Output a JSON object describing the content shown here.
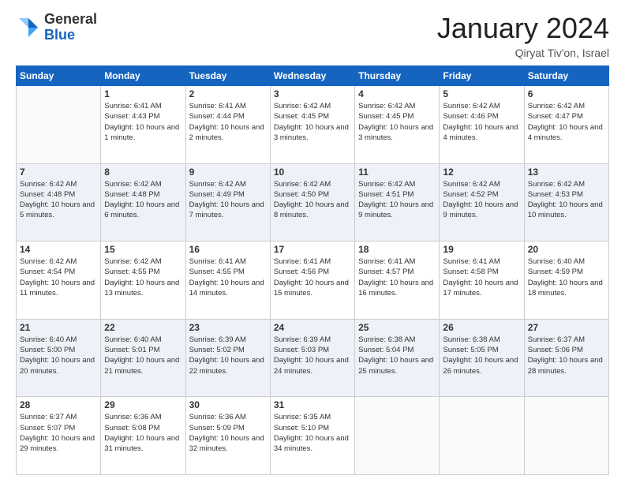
{
  "header": {
    "logo": {
      "line1": "General",
      "line2": "Blue"
    },
    "title": "January 2024",
    "location": "Qiryat Tiv'on, Israel"
  },
  "columns": [
    "Sunday",
    "Monday",
    "Tuesday",
    "Wednesday",
    "Thursday",
    "Friday",
    "Saturday"
  ],
  "weeks": [
    [
      {
        "day": "",
        "info": ""
      },
      {
        "day": "1",
        "info": "Sunrise: 6:41 AM\nSunset: 4:43 PM\nDaylight: 10 hours\nand 1 minute."
      },
      {
        "day": "2",
        "info": "Sunrise: 6:41 AM\nSunset: 4:44 PM\nDaylight: 10 hours\nand 2 minutes."
      },
      {
        "day": "3",
        "info": "Sunrise: 6:42 AM\nSunset: 4:45 PM\nDaylight: 10 hours\nand 3 minutes."
      },
      {
        "day": "4",
        "info": "Sunrise: 6:42 AM\nSunset: 4:45 PM\nDaylight: 10 hours\nand 3 minutes."
      },
      {
        "day": "5",
        "info": "Sunrise: 6:42 AM\nSunset: 4:46 PM\nDaylight: 10 hours\nand 4 minutes."
      },
      {
        "day": "6",
        "info": "Sunrise: 6:42 AM\nSunset: 4:47 PM\nDaylight: 10 hours\nand 4 minutes."
      }
    ],
    [
      {
        "day": "7",
        "info": "Sunrise: 6:42 AM\nSunset: 4:48 PM\nDaylight: 10 hours\nand 5 minutes."
      },
      {
        "day": "8",
        "info": "Sunrise: 6:42 AM\nSunset: 4:48 PM\nDaylight: 10 hours\nand 6 minutes."
      },
      {
        "day": "9",
        "info": "Sunrise: 6:42 AM\nSunset: 4:49 PM\nDaylight: 10 hours\nand 7 minutes."
      },
      {
        "day": "10",
        "info": "Sunrise: 6:42 AM\nSunset: 4:50 PM\nDaylight: 10 hours\nand 8 minutes."
      },
      {
        "day": "11",
        "info": "Sunrise: 6:42 AM\nSunset: 4:51 PM\nDaylight: 10 hours\nand 9 minutes."
      },
      {
        "day": "12",
        "info": "Sunrise: 6:42 AM\nSunset: 4:52 PM\nDaylight: 10 hours\nand 9 minutes."
      },
      {
        "day": "13",
        "info": "Sunrise: 6:42 AM\nSunset: 4:53 PM\nDaylight: 10 hours\nand 10 minutes."
      }
    ],
    [
      {
        "day": "14",
        "info": "Sunrise: 6:42 AM\nSunset: 4:54 PM\nDaylight: 10 hours\nand 11 minutes."
      },
      {
        "day": "15",
        "info": "Sunrise: 6:42 AM\nSunset: 4:55 PM\nDaylight: 10 hours\nand 13 minutes."
      },
      {
        "day": "16",
        "info": "Sunrise: 6:41 AM\nSunset: 4:55 PM\nDaylight: 10 hours\nand 14 minutes."
      },
      {
        "day": "17",
        "info": "Sunrise: 6:41 AM\nSunset: 4:56 PM\nDaylight: 10 hours\nand 15 minutes."
      },
      {
        "day": "18",
        "info": "Sunrise: 6:41 AM\nSunset: 4:57 PM\nDaylight: 10 hours\nand 16 minutes."
      },
      {
        "day": "19",
        "info": "Sunrise: 6:41 AM\nSunset: 4:58 PM\nDaylight: 10 hours\nand 17 minutes."
      },
      {
        "day": "20",
        "info": "Sunrise: 6:40 AM\nSunset: 4:59 PM\nDaylight: 10 hours\nand 18 minutes."
      }
    ],
    [
      {
        "day": "21",
        "info": "Sunrise: 6:40 AM\nSunset: 5:00 PM\nDaylight: 10 hours\nand 20 minutes."
      },
      {
        "day": "22",
        "info": "Sunrise: 6:40 AM\nSunset: 5:01 PM\nDaylight: 10 hours\nand 21 minutes."
      },
      {
        "day": "23",
        "info": "Sunrise: 6:39 AM\nSunset: 5:02 PM\nDaylight: 10 hours\nand 22 minutes."
      },
      {
        "day": "24",
        "info": "Sunrise: 6:39 AM\nSunset: 5:03 PM\nDaylight: 10 hours\nand 24 minutes."
      },
      {
        "day": "25",
        "info": "Sunrise: 6:38 AM\nSunset: 5:04 PM\nDaylight: 10 hours\nand 25 minutes."
      },
      {
        "day": "26",
        "info": "Sunrise: 6:38 AM\nSunset: 5:05 PM\nDaylight: 10 hours\nand 26 minutes."
      },
      {
        "day": "27",
        "info": "Sunrise: 6:37 AM\nSunset: 5:06 PM\nDaylight: 10 hours\nand 28 minutes."
      }
    ],
    [
      {
        "day": "28",
        "info": "Sunrise: 6:37 AM\nSunset: 5:07 PM\nDaylight: 10 hours\nand 29 minutes."
      },
      {
        "day": "29",
        "info": "Sunrise: 6:36 AM\nSunset: 5:08 PM\nDaylight: 10 hours\nand 31 minutes."
      },
      {
        "day": "30",
        "info": "Sunrise: 6:36 AM\nSunset: 5:09 PM\nDaylight: 10 hours\nand 32 minutes."
      },
      {
        "day": "31",
        "info": "Sunrise: 6:35 AM\nSunset: 5:10 PM\nDaylight: 10 hours\nand 34 minutes."
      },
      {
        "day": "",
        "info": ""
      },
      {
        "day": "",
        "info": ""
      },
      {
        "day": "",
        "info": ""
      }
    ]
  ]
}
